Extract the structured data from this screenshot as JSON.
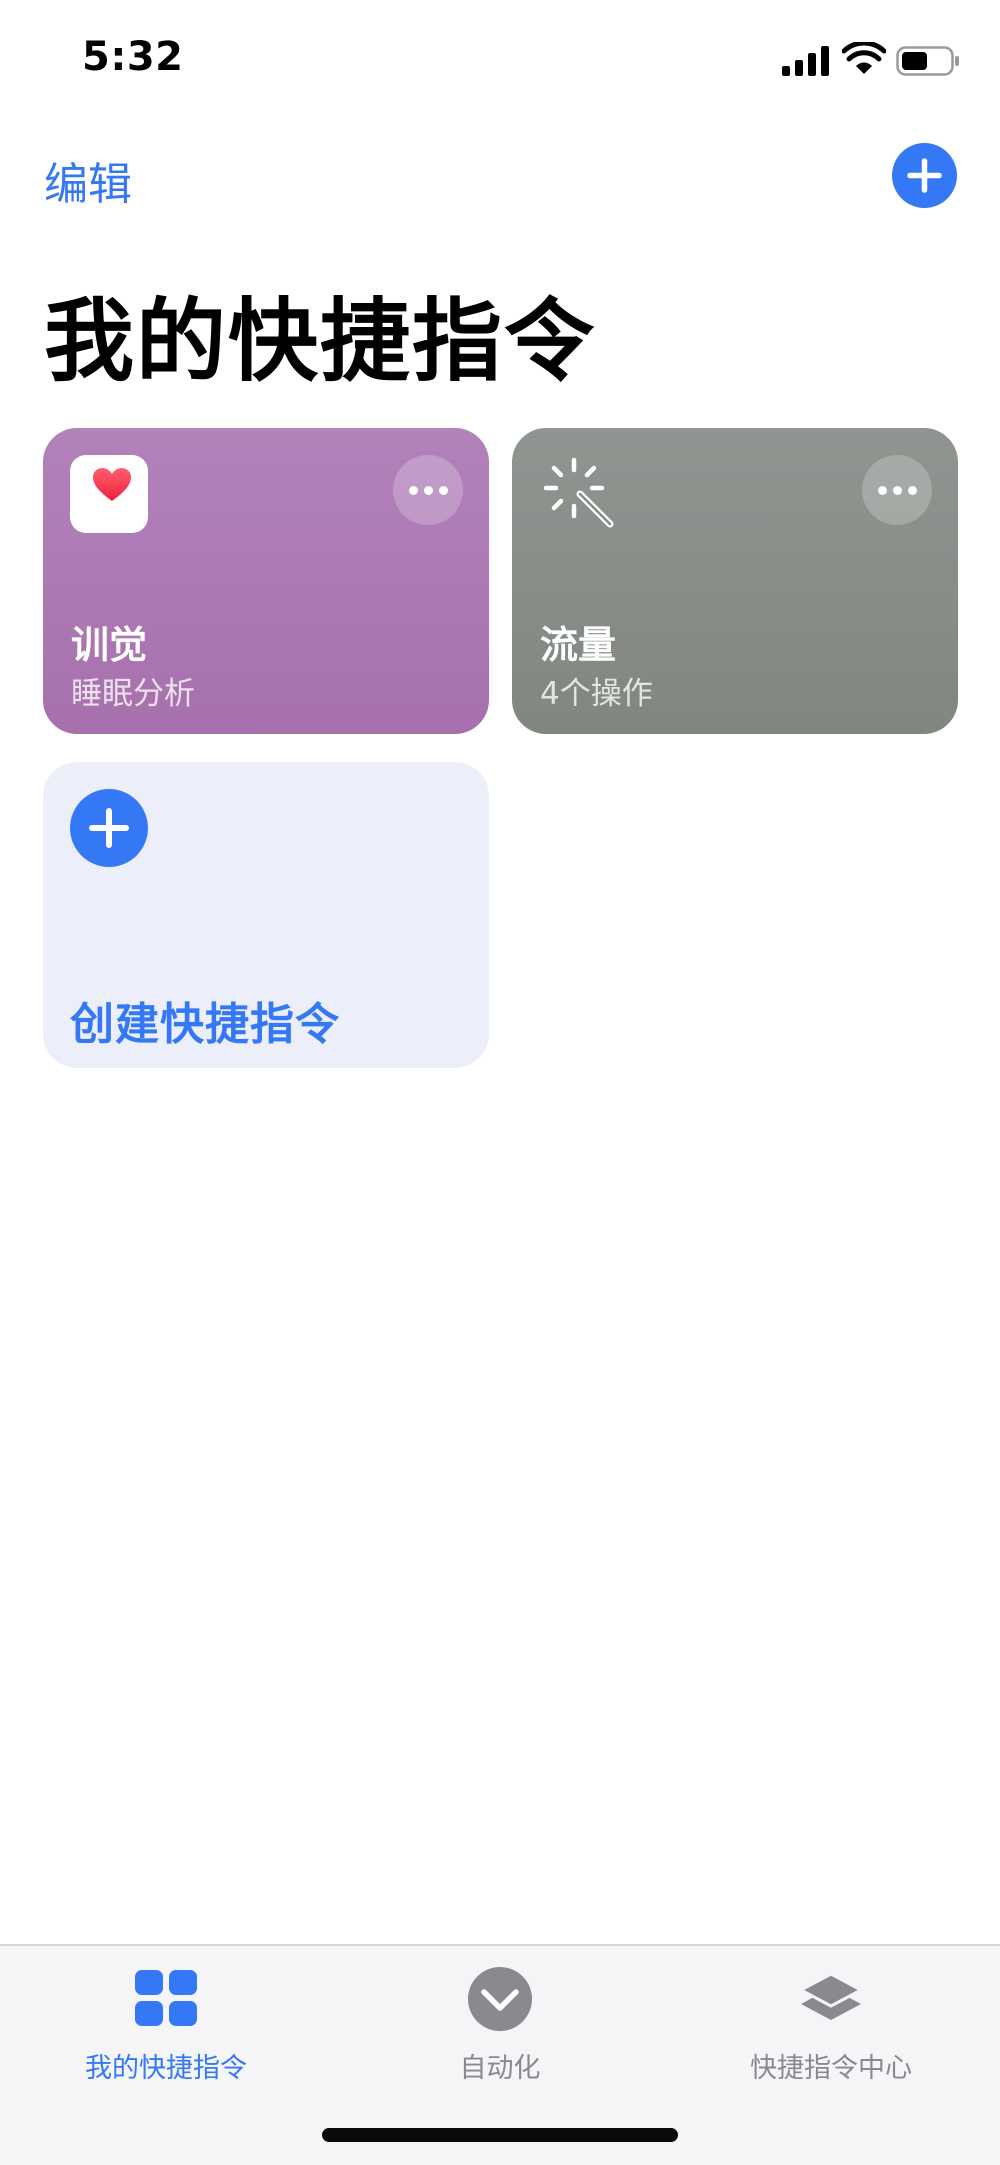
{
  "status_bar": {
    "time": "5:32",
    "icons": [
      "cellular-signal-icon",
      "wifi-icon",
      "battery-icon"
    ],
    "battery_level": 0.55
  },
  "nav": {
    "edit_label": "编辑",
    "add_icon": "plus-icon"
  },
  "page_title": "我的快捷指令",
  "shortcuts": [
    {
      "title": "训觉",
      "subtitle": "睡眠分析",
      "icon": "health-heart-icon",
      "color": "#ab78b3"
    },
    {
      "title": "流量",
      "subtitle": "4个操作",
      "icon": "magic-wand-icon",
      "color": "#878c87"
    }
  ],
  "create": {
    "label": "创建快捷指令",
    "icon": "plus-icon"
  },
  "tab_bar": {
    "items": [
      {
        "label": "我的快捷指令",
        "icon": "grid-icon",
        "active": true
      },
      {
        "label": "自动化",
        "icon": "checkmark-circle-icon",
        "active": false
      },
      {
        "label": "快捷指令中心",
        "icon": "layers-icon",
        "active": false
      }
    ]
  },
  "colors": {
    "accent": "#3478f6",
    "tab_inactive": "#8a8a8e",
    "create_card_bg": "#eceff9"
  }
}
